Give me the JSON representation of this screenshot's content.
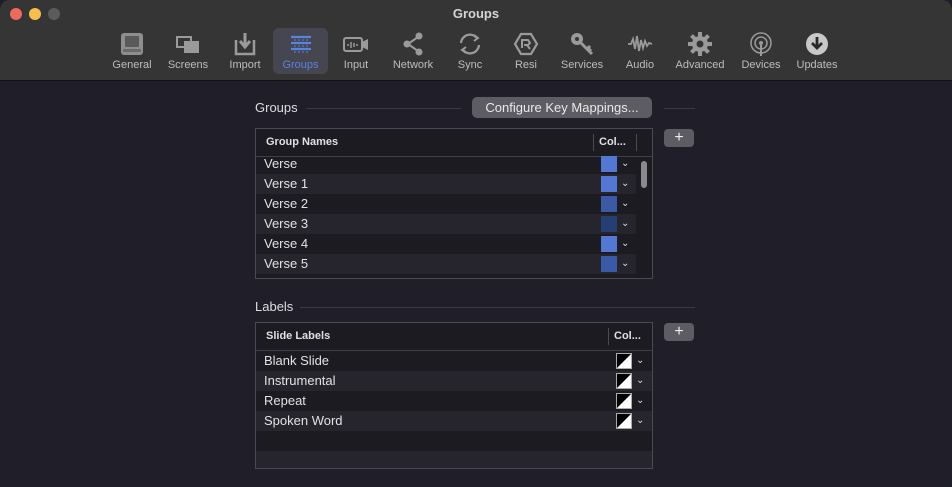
{
  "window": {
    "title": "Groups"
  },
  "toolbar": {
    "items": [
      {
        "label": "General",
        "icon": "general-icon"
      },
      {
        "label": "Screens",
        "icon": "screens-icon"
      },
      {
        "label": "Import",
        "icon": "import-icon"
      },
      {
        "label": "Groups",
        "icon": "groups-icon",
        "selected": true
      },
      {
        "label": "Input",
        "icon": "input-icon"
      },
      {
        "label": "Network",
        "icon": "network-icon"
      },
      {
        "label": "Sync",
        "icon": "sync-icon"
      },
      {
        "label": "Resi",
        "icon": "resi-icon"
      },
      {
        "label": "Services",
        "icon": "services-icon"
      },
      {
        "label": "Audio",
        "icon": "audio-icon"
      },
      {
        "label": "Advanced",
        "icon": "gear-icon"
      },
      {
        "label": "Devices",
        "icon": "devices-icon"
      },
      {
        "label": "Updates",
        "icon": "updates-icon"
      }
    ],
    "accent_color": "#5a82e0"
  },
  "groups_section": {
    "title": "Groups",
    "configure_button": "Configure Key Mappings...",
    "add_button": "+",
    "table": {
      "columns": [
        "Group Names",
        "Col..."
      ],
      "rows": [
        {
          "name": "Verse",
          "color": "#5377d3"
        },
        {
          "name": "Verse 1",
          "color": "#5377d3"
        },
        {
          "name": "Verse 2",
          "color": "#3a5aa6"
        },
        {
          "name": "Verse 3",
          "color": "#253e73"
        },
        {
          "name": "Verse 4",
          "color": "#5377d3"
        },
        {
          "name": "Verse 5",
          "color": "#3a5aa6"
        }
      ]
    }
  },
  "labels_section": {
    "title": "Labels",
    "add_button": "+",
    "table": {
      "columns": [
        "Slide Labels",
        "Col..."
      ],
      "rows": [
        {
          "name": "Blank Slide"
        },
        {
          "name": "Instrumental"
        },
        {
          "name": "Repeat"
        },
        {
          "name": "Spoken Word"
        }
      ]
    }
  }
}
